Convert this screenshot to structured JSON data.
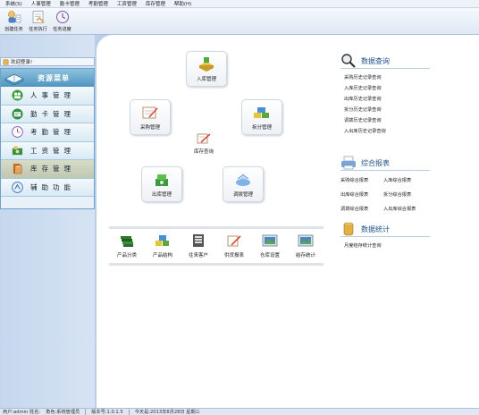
{
  "menu": [
    "系统(S)",
    "人事管理",
    "勤卡管理",
    "考勤管理",
    "工资管理",
    "库存管理",
    "帮助(H)"
  ],
  "toolbar": [
    "创建任务",
    "任务执行",
    "任务进度"
  ],
  "welcome": "欢迎登录!",
  "nav": {
    "header": "资源菜单",
    "items": [
      {
        "label": "人事管理",
        "icon": "people-icon"
      },
      {
        "label": "勤卡管理",
        "icon": "card-icon"
      },
      {
        "label": "考勤管理",
        "icon": "clock-icon"
      },
      {
        "label": "工资管理",
        "icon": "salary-icon"
      },
      {
        "label": "库存管理",
        "icon": "inventory-icon",
        "active": true
      },
      {
        "label": "辅助功能",
        "icon": "assist-icon"
      }
    ]
  },
  "flow": {
    "inbound": "入库管理",
    "purchase": "采购管理",
    "split": "拆分管理",
    "stock_query": "库存查询",
    "outbound": "出库管理",
    "transfer": "调拨管理"
  },
  "base": [
    "产品分类",
    "产品结构",
    "往来客户",
    "供货报表",
    "仓库设置",
    "结存统计"
  ],
  "query": {
    "title": "数据查询",
    "links": [
      "采购历史记录查询",
      "入库历史记录查询",
      "出库历史记录查询",
      "拆分历史记录查询",
      "调拨历史记录查询",
      "入出库历史记录查询"
    ]
  },
  "reports": {
    "title": "综合报表",
    "links": [
      "采购综合报表",
      "入库综合报表",
      "出库综合报表",
      "拆分综合报表",
      "调拨综合报表",
      "入出库综合报表"
    ]
  },
  "stats": {
    "title": "数据统计",
    "links": [
      "月度结存统计查询"
    ]
  },
  "status": [
    "用户:admin 姓名:",
    "角色:系统管理员",
    "版本号:1.0.1.5",
    "今天是:2013年8月28日 星期三"
  ]
}
